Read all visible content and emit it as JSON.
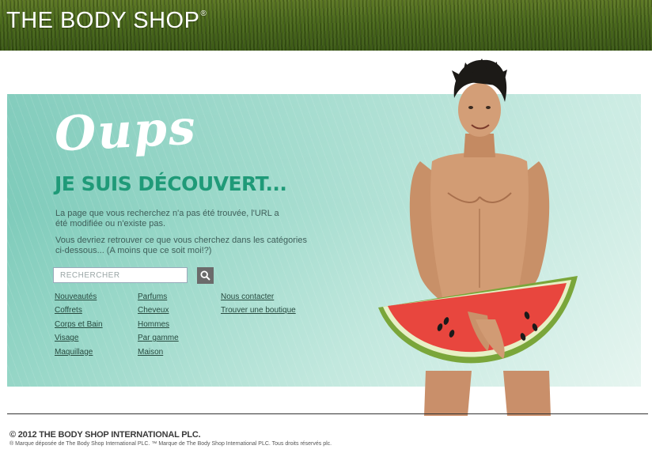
{
  "header": {
    "logo": "THE BODY SHOP",
    "logo_mark": "®"
  },
  "hero": {
    "oops": "Oups",
    "headline": "JE SUIS DÉCOUVERT...",
    "message1": "La page que vous recherchez n'a pas été trouvée, l'URL a été modifiée ou n'existe pas.",
    "message2": "Vous devriez retrouver ce que vous cherchez dans les catégories ci-dessous... (A moins que ce soit moi!?)"
  },
  "search": {
    "placeholder": "RECHERCHER",
    "button_icon": "search-icon"
  },
  "links": {
    "col1": [
      "Nouveautés",
      "Coffrets",
      "Corps et Bain",
      "Visage",
      "Maquillage"
    ],
    "col2": [
      "Parfums",
      "Cheveux",
      "Hommes",
      "Par gamme",
      "Maison"
    ],
    "col3": [
      "Nous contacter",
      "Trouver une boutique"
    ]
  },
  "footer": {
    "copyright": "© 2012 THE BODY SHOP INTERNATIONAL PLC.",
    "legal": "® Marque déposée de The Body Shop International PLC. ™ Marque de The Body Shop International PLC. Tous droits réservés plc."
  },
  "colors": {
    "accent": "#1f9a78",
    "hero_bg": "#9ad8c9",
    "header_green": "#4b6a1c"
  }
}
